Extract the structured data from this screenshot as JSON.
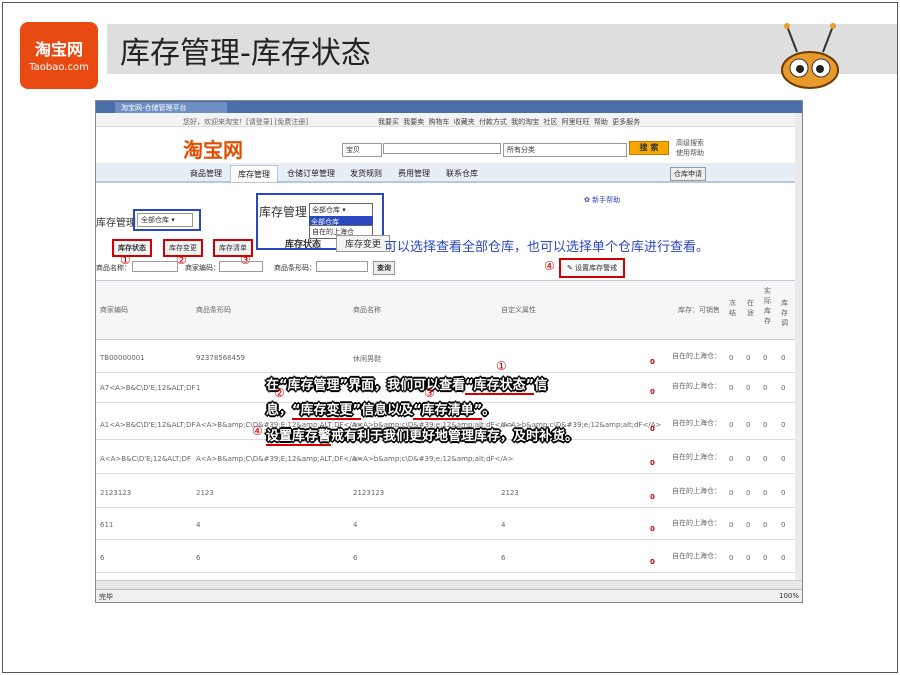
{
  "slide": {
    "title": "库存管理-库存状态",
    "logo_cn": "淘宝网",
    "logo_en": "Taobao.com"
  },
  "browser": {
    "tab_title": "淘宝网-仓储管理平台",
    "top_links": "您好，欢迎来淘宝！[请登录] [免费注册]",
    "top_right_links": [
      "我要买",
      "我要卖",
      "购物车",
      "收藏夹",
      "付款方式",
      "我的淘宝",
      "社区",
      "阿里旺旺",
      "帮助",
      "更多服务"
    ],
    "site_logo": "淘宝网",
    "search_category": "宝贝",
    "search_all": "所有分类",
    "search_button": "搜 索",
    "adv_search": "高级搜索",
    "help": "使用帮助",
    "nav": [
      "商品管理",
      "库存管理",
      "仓储订单管理",
      "发货规则",
      "费用管理",
      "联系仓库"
    ],
    "nav_right": "仓库申请",
    "new_help": "新手帮助",
    "status": "完毕",
    "zoom": "100%"
  },
  "inventory": {
    "label": "库存管理",
    "warehouse_select": "全部仓库",
    "tabs": [
      "库存状态",
      "库存变更",
      "库存清单"
    ],
    "filter_name": "商品名称：",
    "filter_code": "商家编码：",
    "filter_barcode": "商品条形码：",
    "query": "查询",
    "alert_button": "设置库存警戒",
    "columns": [
      "商家编码",
      "商品条形码",
      "商品名称",
      "自定义属性",
      "库存：可销售",
      "冻结",
      "在途",
      "实际库存",
      "库存调"
    ],
    "rows": [
      [
        "TB00000001",
        "92378568459",
        "休闲男鞋",
        ""
      ],
      [
        "A7<A>B&C\\D'E;12&ALT;DF",
        "1",
        "",
        ""
      ],
      [
        "A1<A>B&C\\D'E;12&ALT;DF",
        "A<A>B&amp;C\\D&#39;E;12&amp;ALT;DF</A>",
        "a<A>b&amp;c\\D&#39;e;12&amp;alt;dF</A>",
        "a<A>b&amp;c\\D&#39;e;12&amp;alt;dF</A>"
      ],
      [
        "A<A>B&C\\D'E;12&ALT;DF",
        "A<A>B&amp;C\\D&#39;E;12&amp;ALT;DF</A>",
        "a<A>b&amp;c\\D&#39;e;12&amp;alt;dF</A>",
        ""
      ],
      [
        "2123123",
        "2123",
        "2123123",
        "2123"
      ],
      [
        "611",
        "4",
        "4",
        "4"
      ],
      [
        "6",
        "6",
        "6",
        "6"
      ]
    ],
    "row_stock": "0",
    "row_warehouse": "自在的上海仓：",
    "row_nums": [
      "0",
      "0",
      "0",
      "0"
    ]
  },
  "zoom_popup": {
    "label": "库存管理",
    "select": "全部仓库",
    "options": [
      "全部仓库",
      "自在的上海仓"
    ],
    "tabs": [
      "库存状态",
      "库存变更"
    ]
  },
  "annotations": {
    "blue_note": "可以选择查看全部仓库，也可以选择单个仓库进行查看。",
    "n1": "①",
    "n2": "②",
    "n3": "③",
    "n4": "④",
    "line1a": "在“库存管理”界面，我们可以查看",
    "line1b": "“库存状态”",
    "line1c": "信",
    "line2a": "息，",
    "line2b": "“库存变更”",
    "line2c": "信息以及",
    "line2d": "“库存清单”",
    "line2e": "。",
    "line3a": "设置库存警",
    "line3b": "戒有利于我们更好地管理库存，及时补货。"
  }
}
